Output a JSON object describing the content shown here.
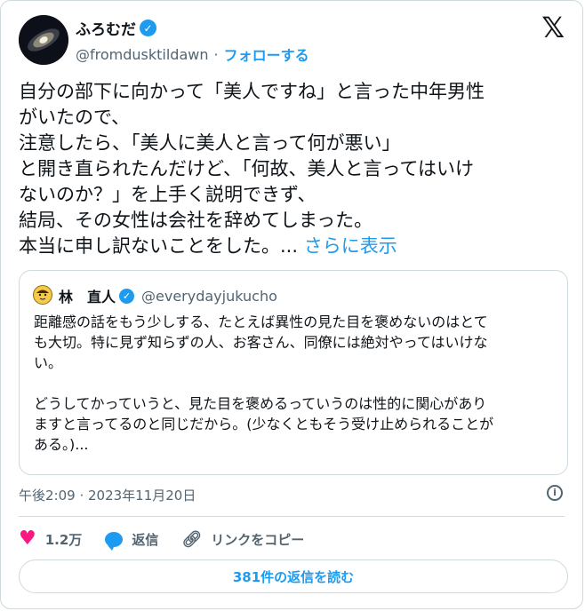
{
  "author": {
    "display_name": "ふろむだ",
    "handle": "@fromdusktildawn",
    "separator": "·",
    "follow_label": "フォローする",
    "verified_icon": "verified-badge-icon"
  },
  "brand_logo": "𝕏",
  "tweet": {
    "lines": [
      "自分の部下に向かって「美人ですね」と言った中年男性",
      "がいたので、",
      "注意したら、「美人に美人と言って何が悪い」",
      "と開き直られたんだけど、「何故、美人と言ってはいけ",
      "ないのか？」を上手く説明できず、",
      "結局、その女性は会社を辞めてしまった。",
      "本当に申し訳ないことをした。..."
    ],
    "show_more": "さらに表示"
  },
  "quoted": {
    "display_name": "林　直人",
    "handle": "@everydayjukucho",
    "lines": [
      "距離感の話をもう少しする、たとえば異性の見た目を褒めないのはとて",
      "も大切。特に見ず知らずの人、お客さん、同僚には絶対やってはいけな",
      "い。",
      "",
      "どうしてかっていうと、見た目を褒めるっていうのは性的に関心があり",
      "ますと言ってるのと同じだから。(少なくともそう受け止められることが",
      "ある。)..."
    ]
  },
  "meta": {
    "timestamp": "午後2:09 · 2023年11月20日",
    "info_icon": "i"
  },
  "actions": {
    "like_count": "1.2万",
    "reply_label": "返信",
    "copy_link_label": "リンクをコピー"
  },
  "read_replies_label": "381件の返信を読む",
  "colors": {
    "accent": "#1d9bf0",
    "like": "#f91880",
    "secondary_text": "#536471",
    "border": "#cfd9de"
  }
}
